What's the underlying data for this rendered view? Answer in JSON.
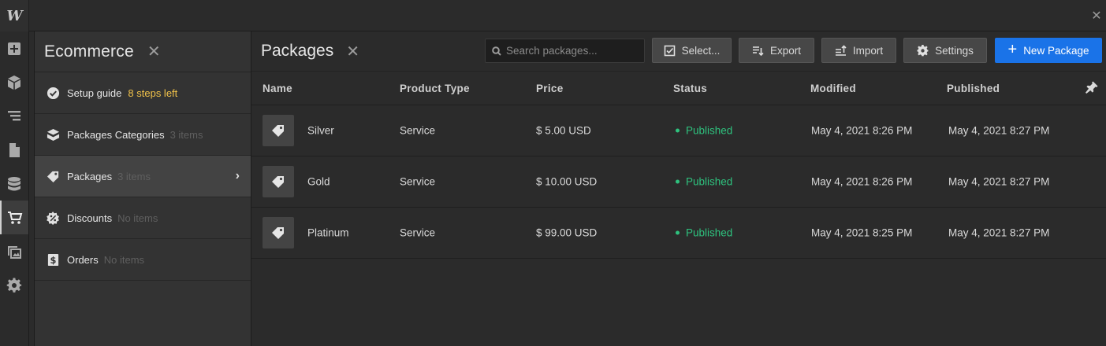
{
  "app": {
    "logo_text": "W"
  },
  "rail": {
    "items": [
      {
        "icon": "add-icon"
      },
      {
        "icon": "box-icon"
      },
      {
        "icon": "navigator-icon"
      },
      {
        "icon": "pages-icon"
      },
      {
        "icon": "cms-icon"
      },
      {
        "icon": "cart-icon",
        "active": true
      },
      {
        "icon": "assets-icon"
      },
      {
        "icon": "settings-gear-icon"
      }
    ]
  },
  "panel": {
    "title": "Ecommerce",
    "items": [
      {
        "label": "Setup guide",
        "extra": "8 steps left",
        "icon": "check-circle-icon"
      },
      {
        "label": "Packages Categories",
        "count": "3 items",
        "icon": "category-icon"
      },
      {
        "label": "Packages",
        "count": "3 items",
        "icon": "tag-icon",
        "active": true
      },
      {
        "label": "Discounts",
        "count": "No items",
        "icon": "discount-icon"
      },
      {
        "label": "Orders",
        "count": "No items",
        "icon": "receipt-icon"
      }
    ]
  },
  "main": {
    "title": "Packages",
    "search": {
      "placeholder": "Search packages..."
    },
    "toolbar": {
      "select_label": "Select...",
      "export_label": "Export",
      "import_label": "Import",
      "settings_label": "Settings",
      "new_label": "New Package"
    },
    "columns": [
      "Name",
      "Product Type",
      "Price",
      "Status",
      "Modified",
      "Published"
    ],
    "rows": [
      {
        "name": "Silver",
        "type": "Service",
        "price": "$ 5.00 USD",
        "status": "Published",
        "modified": "May 4, 2021 8:26 PM",
        "published": "May 4, 2021 8:27 PM"
      },
      {
        "name": "Gold",
        "type": "Service",
        "price": "$ 10.00 USD",
        "status": "Published",
        "modified": "May 4, 2021 8:26 PM",
        "published": "May 4, 2021 8:27 PM"
      },
      {
        "name": "Platinum",
        "type": "Service",
        "price": "$ 99.00 USD",
        "status": "Published",
        "modified": "May 4, 2021 8:25 PM",
        "published": "May 4, 2021 8:27 PM"
      }
    ]
  },
  "colors": {
    "accent": "#1a73e8",
    "status_published": "#2ec27e",
    "steps_left": "#f0c24a"
  }
}
